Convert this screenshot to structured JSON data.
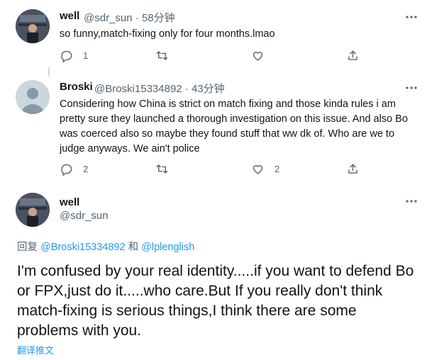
{
  "tweets": [
    {
      "name": "well",
      "handle": "@sdr_sun",
      "time": "58分钟",
      "text": "so funny,match-fixing only for four months.lmao",
      "reply_count": "1",
      "like_count": ""
    },
    {
      "name": "Broski",
      "handle": "@Broski15334892",
      "time": "43分钟",
      "text": "Considering how China is strict on match fixing and those kinda rules i am pretty sure they launched a thorough investigation on this issue. And also Bo was coerced also so maybe they found stuff that ww dk of. Who are we to judge anyways. We ain't police",
      "reply_count": "2",
      "like_count": "2"
    }
  ],
  "focused": {
    "name": "well",
    "handle": "@sdr_sun",
    "reply_prefix": "回复",
    "reply_user1": "@Broski15334892",
    "reply_joiner": "和",
    "reply_user2": "@lplenglish",
    "text": "I'm confused by your real identity.....if you want to defend Bo or FPX,just do it.....who care.But If you really don't think match-fixing is serious things,I think there are some problems with you.",
    "translate_label": "翻译推文"
  },
  "colors": {
    "accent": "#1d9bf0",
    "secondary_text": "#536471",
    "primary_text": "#0f1419"
  },
  "icons": [
    "more-icon",
    "reply-icon",
    "retweet-icon",
    "like-icon",
    "share-icon"
  ]
}
